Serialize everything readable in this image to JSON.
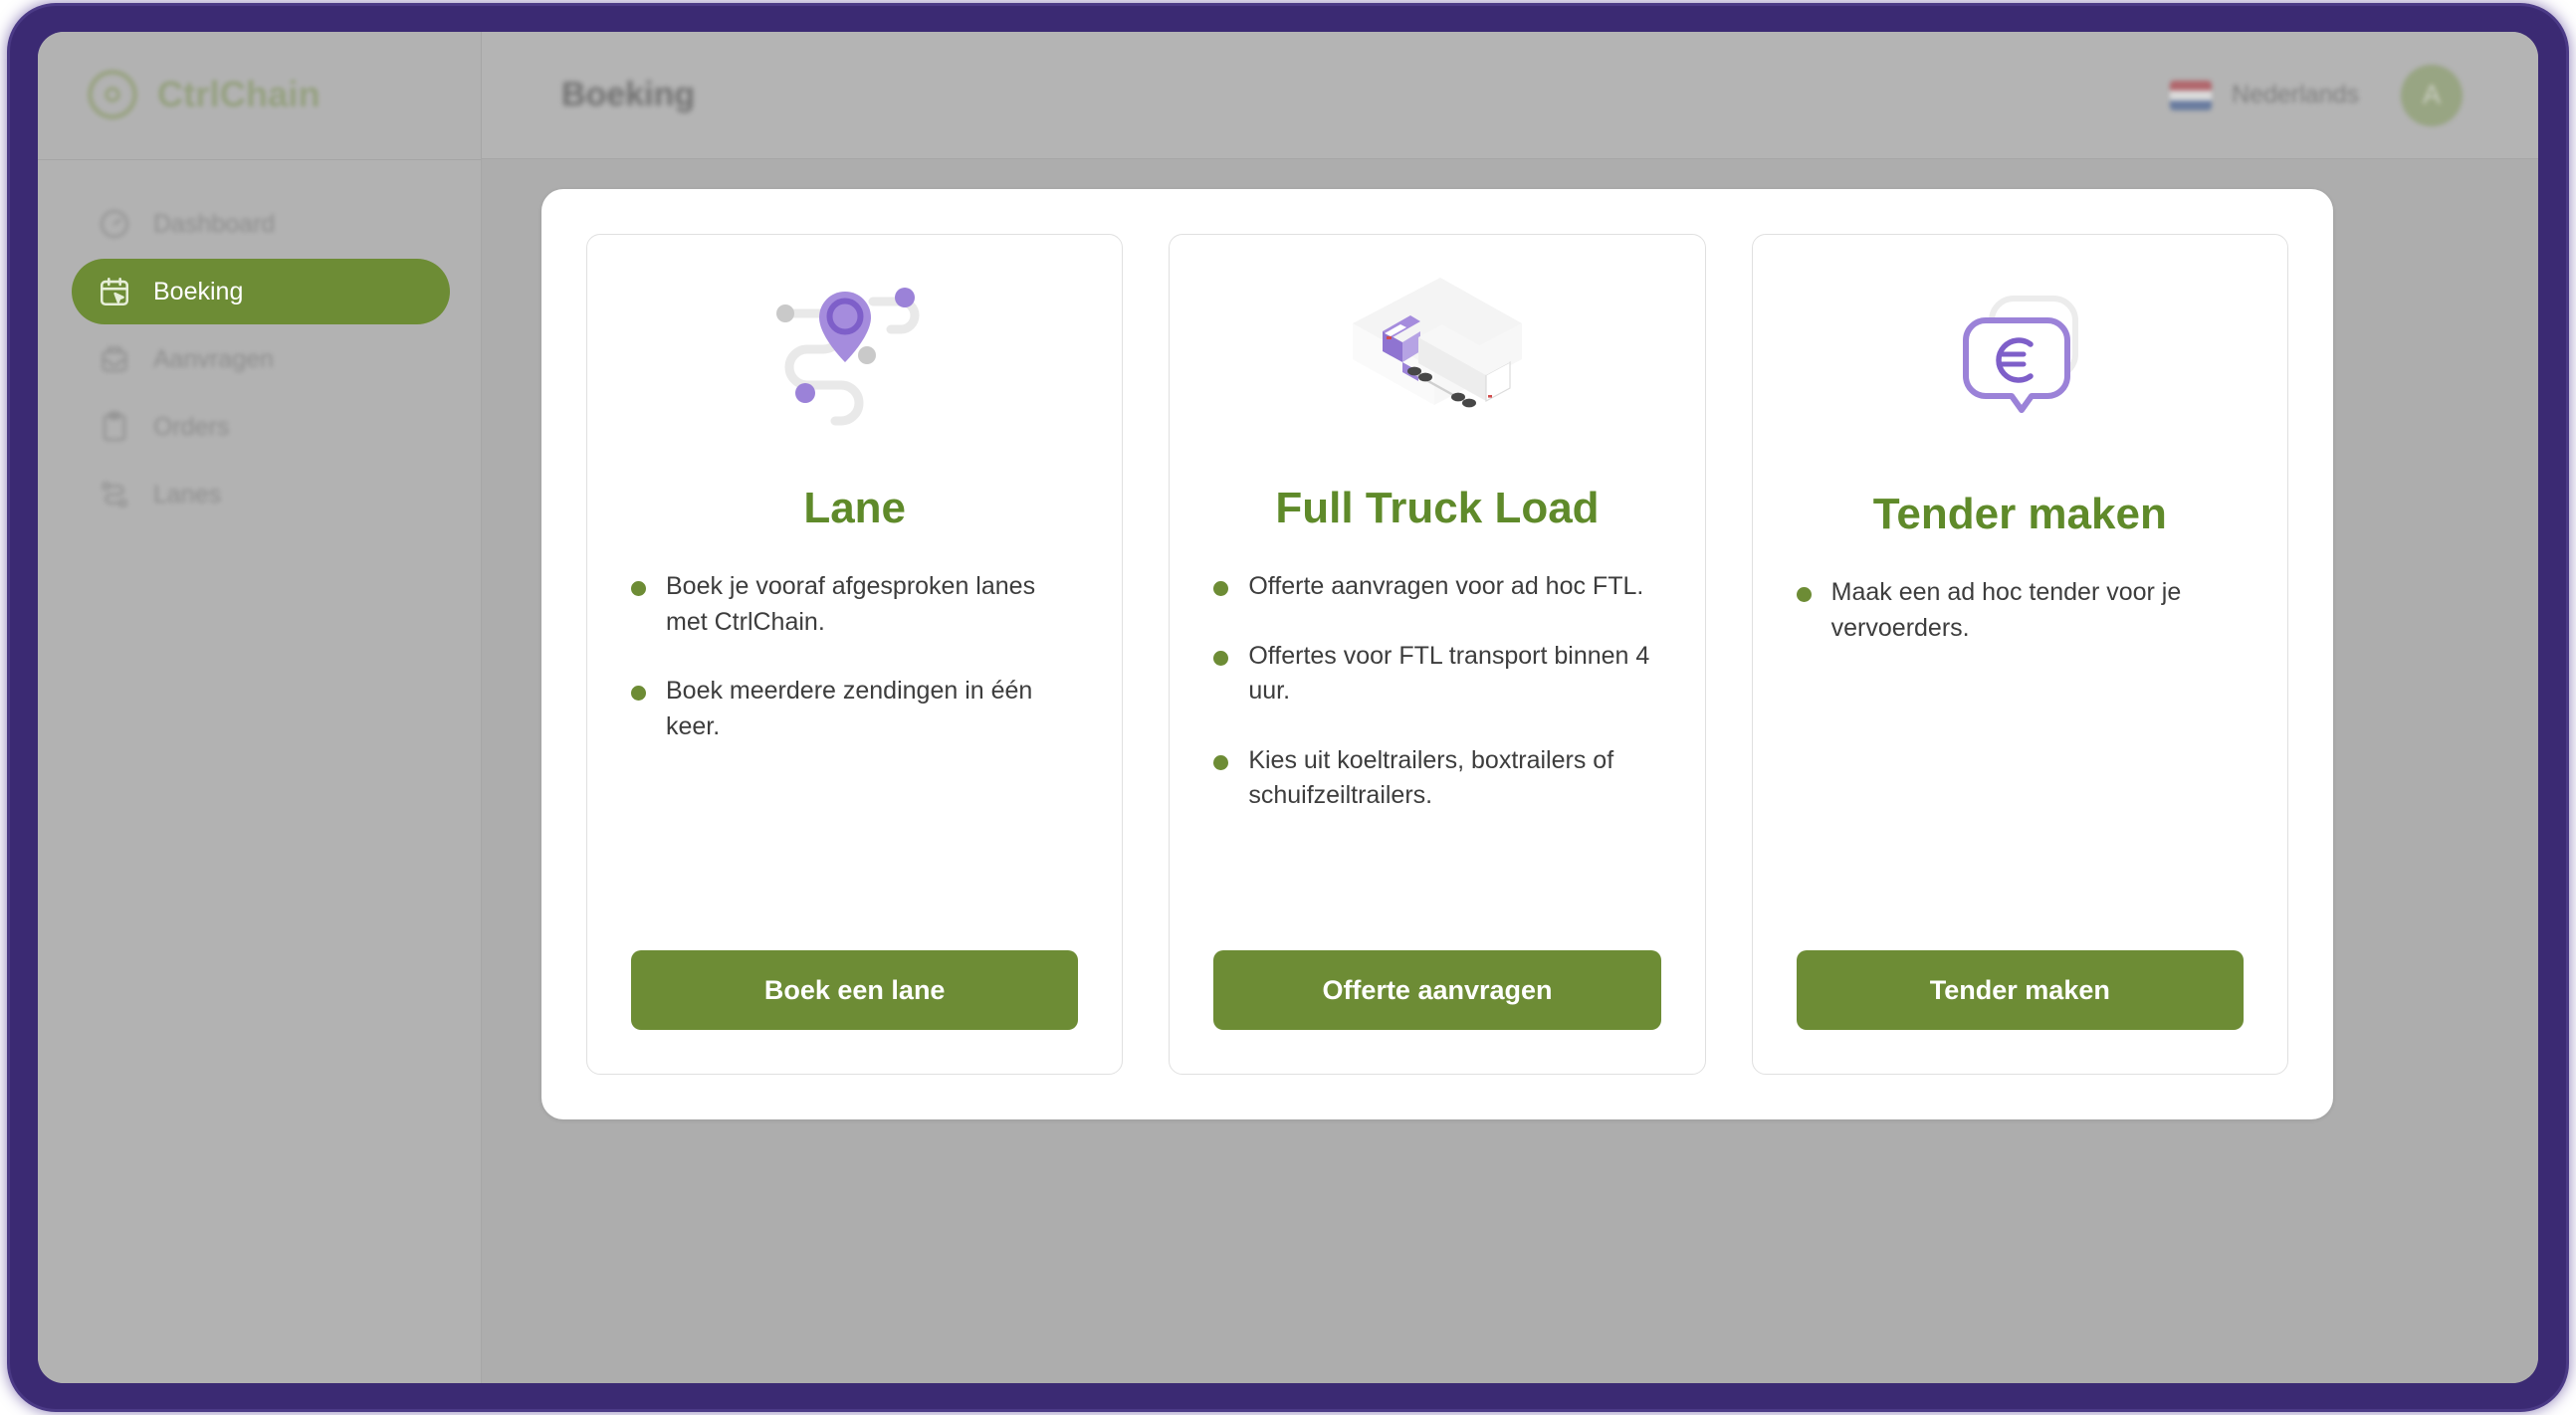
{
  "app": {
    "brand": "CtrlChain",
    "logo_icon": "target-circle-icon"
  },
  "sidebar": {
    "items": [
      {
        "label": "Dashboard",
        "icon": "gauge-icon",
        "active": false
      },
      {
        "label": "Boeking",
        "icon": "calendar-click-icon",
        "active": true
      },
      {
        "label": "Aanvragen",
        "icon": "inbox-icon",
        "active": false
      },
      {
        "label": "Orders",
        "icon": "clipboard-icon",
        "active": false
      },
      {
        "label": "Lanes",
        "icon": "route-icon",
        "active": false
      }
    ]
  },
  "header": {
    "title": "Boeking",
    "language": {
      "label": "Nederlands",
      "flag": "dutch-flag-icon"
    },
    "avatar": {
      "initial": "A",
      "color": "#7d9652"
    }
  },
  "colors": {
    "green": "#6d8c35",
    "green_text": "#5f8a2a",
    "purple_accent": "#9b82d8",
    "frame_purple": "#3b2a73"
  },
  "cards": [
    {
      "id": "lane",
      "art": "route-pin-illustration",
      "title": "Lane",
      "bullets": [
        "Boek je vooraf afgesproken lanes met CtrlChain.",
        "Boek meerdere zendingen in één keer."
      ],
      "cta": "Boek een lane"
    },
    {
      "id": "full-truck-load",
      "art": "isometric-truck-illustration",
      "title": "Full Truck Load",
      "bullets": [
        "Offerte aanvragen voor ad hoc FTL.",
        "Offertes voor FTL transport binnen 4 uur.",
        "Kies uit koeltrailers, boxtrailers of schuifzeiltrailers."
      ],
      "cta": "Offerte aanvragen"
    },
    {
      "id": "tender",
      "art": "euro-speech-bubble-illustration",
      "title": "Tender maken",
      "bullets": [
        "Maak een ad hoc tender voor je vervoerders."
      ],
      "cta": "Tender maken"
    }
  ]
}
